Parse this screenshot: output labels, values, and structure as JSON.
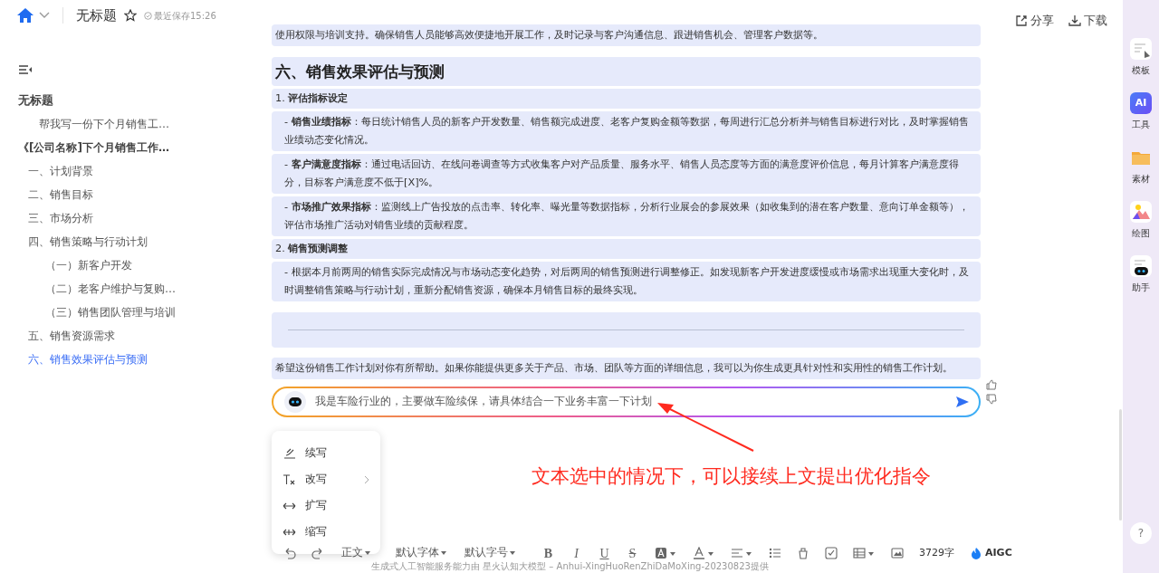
{
  "header": {
    "title": "无标题",
    "saved_status": "最近保存15:26",
    "starred": false,
    "actions": [
      "分享",
      "下载"
    ]
  },
  "outline": {
    "title": "无标题",
    "items": [
      {
        "text": "帮我写一份下个月销售工…",
        "kind": "prompt",
        "selected": false
      },
      {
        "text": "《[公司名称]下个月销售工作…",
        "kind": "document",
        "selected": false,
        "children": [
          {
            "text": "一、计划背景",
            "selected": false
          },
          {
            "text": "二、销售目标",
            "selected": false
          },
          {
            "text": "三、市场分析",
            "selected": false
          },
          {
            "text": "四、销售策略与行动计划",
            "selected": false,
            "children": [
              {
                "text": "（一）新客户开发",
                "selected": false
              },
              {
                "text": "（二）老客户维护与复购…",
                "selected": false
              },
              {
                "text": "（三）销售团队管理与培训",
                "selected": false
              }
            ]
          },
          {
            "text": "五、销售资源需求",
            "selected": false
          },
          {
            "text": "六、销售效果评估与预测",
            "selected": true
          }
        ]
      }
    ]
  },
  "document": {
    "blocks": [
      {
        "kind": "paragraph",
        "text": "使用权限与培训支持。确保销售人员能够高效便捷地开展工作，及时记录与客户沟通信息、跟进销售机会、管理客户数据等。"
      },
      {
        "kind": "heading",
        "text": "六、销售效果评估与预测"
      },
      {
        "kind": "subheading",
        "text": "1. **评估指标设定**"
      },
      {
        "kind": "bullet",
        "text": "- **销售业绩指标**：每日统计销售人员的新客户开发数量、销售额完成进度、老客户复购金额等数据，每周进行汇总分析并与销售目标进行对比，及时掌握销售业绩动态变化情况。"
      },
      {
        "kind": "bullet",
        "text": "- **客户满意度指标**：通过电话回访、在线问卷调查等方式收集客户对产品质量、服务水平、销售人员态度等方面的满意度评价信息，每月计算客户满意度得分，目标客户满意度不低于[X]%。"
      },
      {
        "kind": "bullet",
        "text": "- **市场推广效果指标**：监测线上广告投放的点击率、转化率、曝光量等数据指标，分析行业展会的参展效果（如收集到的潜在客户数量、意向订单金额等），评估市场推广活动对销售业绩的贡献程度。"
      },
      {
        "kind": "subheading",
        "text": "2. **销售预测调整**"
      },
      {
        "kind": "bullet",
        "text": "- 根据本月前两周的销售实际完成情况与市场动态变化趋势，对后两周的销售预测进行调整修正。如发现新客户开发进度缓慢或市场需求出现重大变化时，及时调整销售策略与行动计划，重新分配销售资源，确保本月销售目标的最终实现。"
      },
      {
        "kind": "divider"
      },
      {
        "kind": "paragraph",
        "text": "希望这份销售工作计划对你有所帮助。如果你能提供更多关于产品、市场、团队等方面的详细信息，我可以为你生成更具针对性和实用性的销售工作计划。"
      }
    ]
  },
  "prompt": {
    "value": "我是车险行业的，主要做车险续保，请具体结合一下业务丰富一下计划"
  },
  "rewrite_menu": [
    {
      "label": "续写",
      "has_submenu": false
    },
    {
      "label": "改写",
      "has_submenu": true
    },
    {
      "label": "扩写",
      "has_submenu": false
    },
    {
      "label": "缩写",
      "has_submenu": false
    }
  ],
  "annotation": {
    "text": "文本选中的情况下，可以接续上文提出优化指令",
    "color": "#ff2a1f"
  },
  "toolbar": {
    "paragraph_style": "正文",
    "font": "默认字体",
    "font_size": "默认字号",
    "format_buttons": [
      "B",
      "I",
      "U",
      "S"
    ],
    "word_count": "3729字",
    "aigc": "AIGC"
  },
  "footer": "生成式人工智能服务能力由 星火认知大模型 – Anhui-XingHuoRenZhiDaMoXing-20230823提供",
  "rail": {
    "items": [
      {
        "label": "模板"
      },
      {
        "label": "工具",
        "badge": "AI"
      },
      {
        "label": "素材"
      },
      {
        "label": "绘图"
      },
      {
        "label": "助手"
      }
    ],
    "help": "?"
  }
}
